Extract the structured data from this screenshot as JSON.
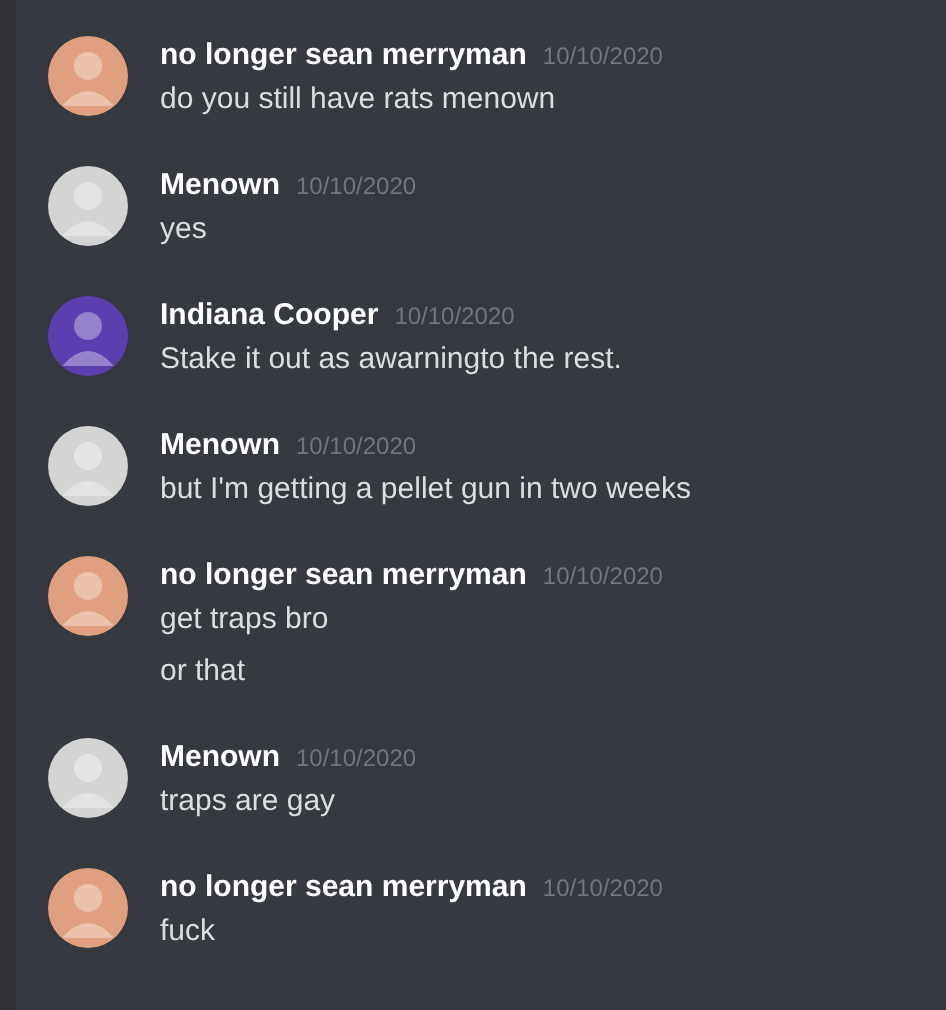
{
  "messages": [
    {
      "author": "no longer sean merryman",
      "timestamp": "10/10/2020",
      "color": "#e0a080",
      "lines": [
        "do you still have rats menown"
      ]
    },
    {
      "author": "Menown",
      "timestamp": "10/10/2020",
      "color": "#d4d4d4",
      "lines": [
        "yes"
      ]
    },
    {
      "author": "Indiana Cooper",
      "timestamp": "10/10/2020",
      "color": "#5b3fb0",
      "lines": [
        "Stake it out as awarningto the rest."
      ]
    },
    {
      "author": "Menown",
      "timestamp": "10/10/2020",
      "color": "#d4d4d4",
      "lines": [
        "but I'm getting a pellet gun in two weeks"
      ]
    },
    {
      "author": "no longer sean merryman",
      "timestamp": "10/10/2020",
      "color": "#e0a080",
      "lines": [
        "get traps bro",
        "or that"
      ]
    },
    {
      "author": "Menown",
      "timestamp": "10/10/2020",
      "color": "#d4d4d4",
      "lines": [
        "traps are gay"
      ]
    },
    {
      "author": "no longer sean merryman",
      "timestamp": "10/10/2020",
      "color": "#e0a080",
      "lines": [
        "fuck"
      ]
    }
  ]
}
